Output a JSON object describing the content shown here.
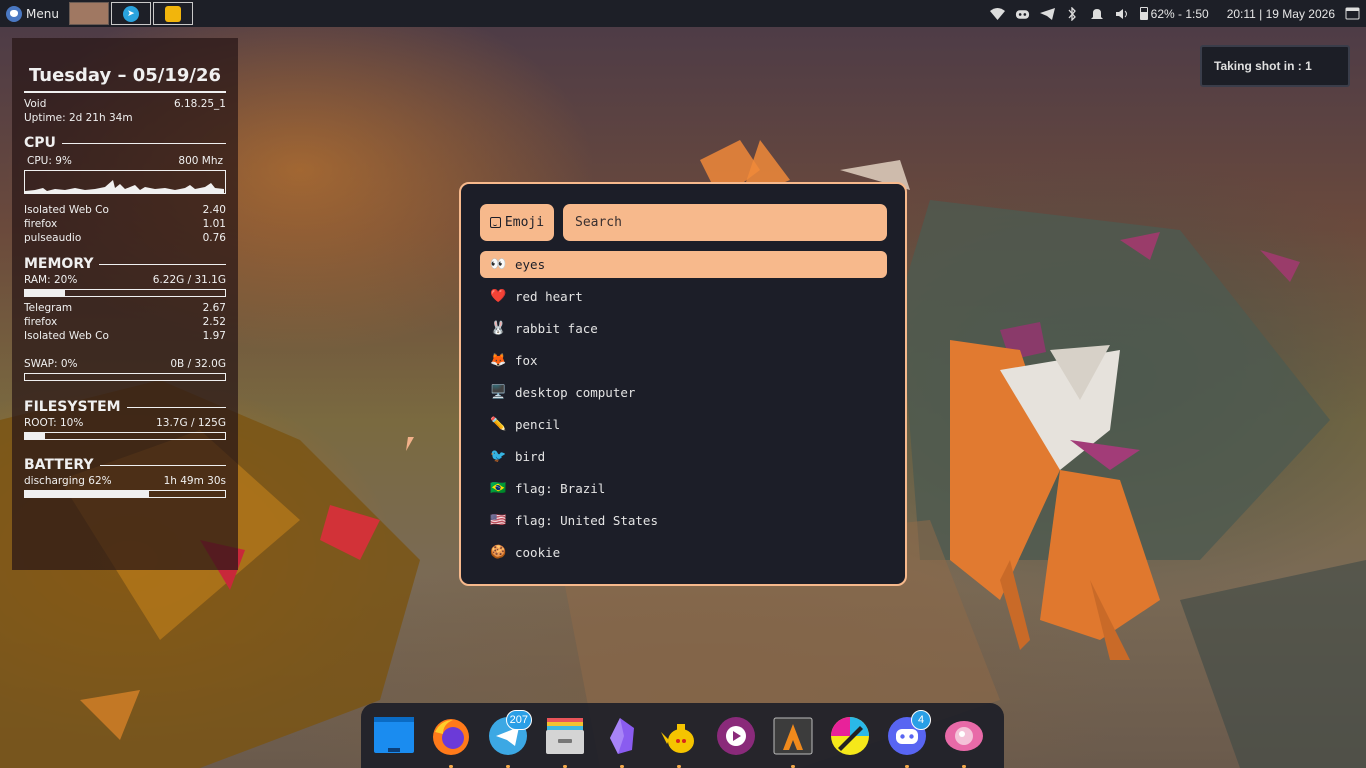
{
  "panel": {
    "menu_label": "Menu",
    "battery": "62% - 1:50",
    "datetime": "20:11 | 19 May 2026",
    "tray_icons": [
      "wifi-icon",
      "discord-icon",
      "telegram-icon",
      "bluetooth-icon",
      "notifications-icon",
      "volume-icon",
      "battery-icon",
      "window-icon"
    ]
  },
  "conky": {
    "date": "Tuesday – 05/19/26",
    "os": "Void",
    "kernel": "6.18.25_1",
    "uptime": "Uptime: 2d 21h 34m",
    "cpu": {
      "title": "CPU",
      "usage": "CPU: 9%",
      "freq": "800 Mhz",
      "top": [
        {
          "name": "Isolated Web Co",
          "value": "2.40"
        },
        {
          "name": "firefox",
          "value": "1.01"
        },
        {
          "name": "pulseaudio",
          "value": "0.76"
        }
      ]
    },
    "memory": {
      "title": "MEMORY",
      "ram_label": "RAM: 20%",
      "ram_value": "6.22G / 31.1G",
      "ram_fraction": 0.2,
      "top": [
        {
          "name": "Telegram",
          "value": "2.67"
        },
        {
          "name": "firefox",
          "value": "2.52"
        },
        {
          "name": "Isolated Web Co",
          "value": "1.97"
        }
      ],
      "swap_label": "SWAP: 0%",
      "swap_value": "0B / 32.0G",
      "swap_fraction": 0.0
    },
    "filesystem": {
      "title": "FILESYSTEM",
      "root_label": "ROOT:  10%",
      "root_value": "13.7G / 125G",
      "root_fraction": 0.1
    },
    "battery": {
      "title": "BATTERY",
      "status": "discharging 62%",
      "time": "1h 49m 30s",
      "fraction": 0.62
    }
  },
  "notification": {
    "text": "Taking shot in : 1"
  },
  "picker": {
    "mode_label": "Emoji",
    "search_placeholder": "Search",
    "accent": "#f7b98c",
    "items": [
      {
        "glyph": "👀",
        "label": "eyes"
      },
      {
        "glyph": "❤️",
        "label": "red heart"
      },
      {
        "glyph": "🐰",
        "label": "rabbit face"
      },
      {
        "glyph": "🦊",
        "label": "fox"
      },
      {
        "glyph": "🖥️",
        "label": "desktop computer"
      },
      {
        "glyph": "✏️",
        "label": "pencil"
      },
      {
        "glyph": "🐦",
        "label": "bird"
      },
      {
        "glyph": "🇧🇷",
        "label": "flag: Brazil"
      },
      {
        "glyph": "🇺🇸",
        "label": "flag: United States"
      },
      {
        "glyph": "🍪",
        "label": "cookie"
      }
    ]
  },
  "dock": {
    "apps": [
      {
        "name": "desktop-app",
        "badge": ""
      },
      {
        "name": "firefox",
        "badge": ""
      },
      {
        "name": "telegram",
        "badge": "207"
      },
      {
        "name": "file-manager",
        "badge": ""
      },
      {
        "name": "obsidian",
        "badge": ""
      },
      {
        "name": "teapot-app",
        "badge": ""
      },
      {
        "name": "media-player",
        "badge": ""
      },
      {
        "name": "alacritty",
        "badge": ""
      },
      {
        "name": "krita",
        "badge": ""
      },
      {
        "name": "discord",
        "badge": "4"
      },
      {
        "name": "eye-app",
        "badge": ""
      }
    ]
  }
}
